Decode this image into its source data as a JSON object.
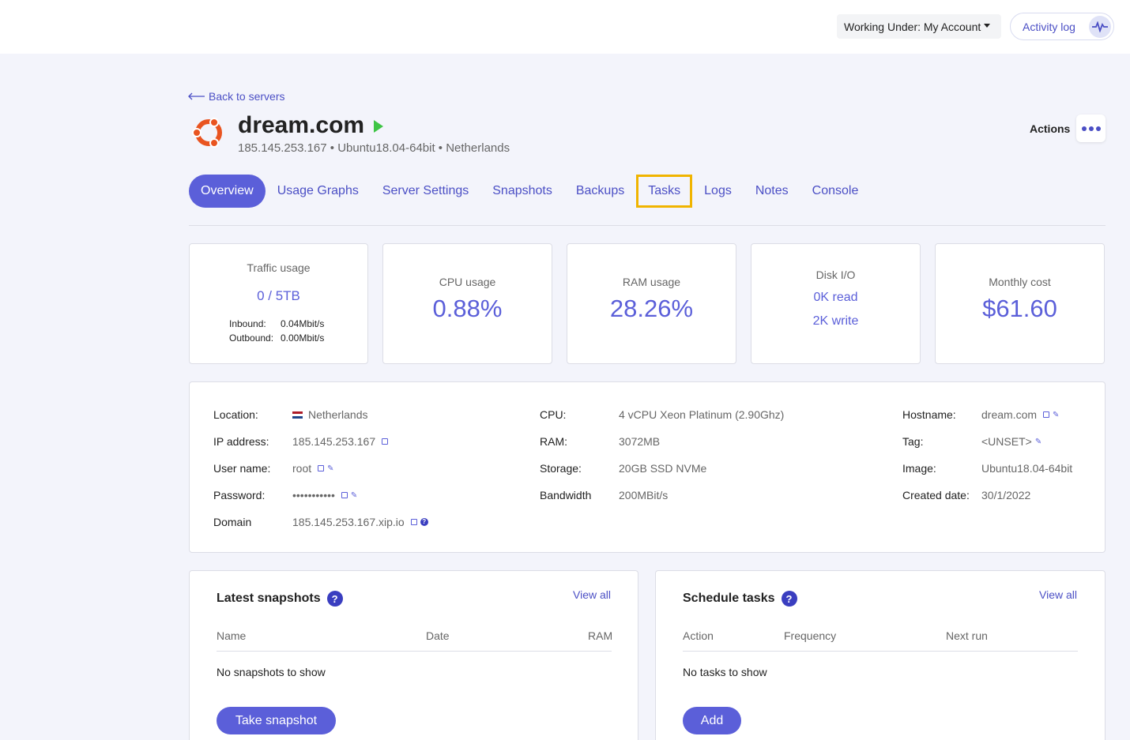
{
  "topbar": {
    "working_under": "Working Under: My Account",
    "activity_log": "Activity log"
  },
  "header": {
    "back_label": "Back to servers",
    "server_name": "dream.com",
    "subtitle": "185.145.253.167 • Ubuntu18.04-64bit • Netherlands",
    "actions_label": "Actions"
  },
  "tabs": [
    {
      "label": "Overview",
      "active": true
    },
    {
      "label": "Usage Graphs"
    },
    {
      "label": "Server Settings"
    },
    {
      "label": "Snapshots"
    },
    {
      "label": "Backups"
    },
    {
      "label": "Tasks",
      "highlighted": true
    },
    {
      "label": "Logs"
    },
    {
      "label": "Notes"
    },
    {
      "label": "Console"
    }
  ],
  "stats": {
    "traffic": {
      "label": "Traffic usage",
      "value": "0 / 5TB",
      "inbound_label": "Inbound:",
      "inbound_value": "0.04Mbit/s",
      "outbound_label": "Outbound:",
      "outbound_value": "0.00Mbit/s"
    },
    "cpu": {
      "label": "CPU usage",
      "value": "0.88%"
    },
    "ram": {
      "label": "RAM usage",
      "value": "28.26%"
    },
    "disk": {
      "label": "Disk I/O",
      "read": "0K read",
      "write": "2K write"
    },
    "cost": {
      "label": "Monthly cost",
      "value": "$61.60"
    }
  },
  "info": {
    "location_label": "Location:",
    "location": "Netherlands",
    "ip_label": "IP address:",
    "ip": "185.145.253.167",
    "user_label": "User name:",
    "user": "root",
    "password_label": "Password:",
    "password": "•••••••••••",
    "domain_label": "Domain",
    "domain": "185.145.253.167.xip.io",
    "cpu_label": "CPU:",
    "cpu": "4 vCPU Xeon Platinum (2.90Ghz)",
    "ram_label": "RAM:",
    "ram": "3072MB",
    "storage_label": "Storage:",
    "storage": "20GB SSD NVMe",
    "bandwidth_label": "Bandwidth",
    "bandwidth": "200MBit/s",
    "hostname_label": "Hostname:",
    "hostname": "dream.com",
    "tag_label": "Tag:",
    "tag": "<UNSET>",
    "image_label": "Image:",
    "image": "Ubuntu18.04-64bit",
    "created_label": "Created date:",
    "created": "30/1/2022"
  },
  "snapshots": {
    "title": "Latest snapshots",
    "view_all": "View all",
    "columns": [
      "Name",
      "Date",
      "RAM"
    ],
    "empty": "No snapshots to show",
    "button": "Take snapshot"
  },
  "tasks": {
    "title": "Schedule tasks",
    "view_all": "View all",
    "columns": [
      "Action",
      "Frequency",
      "Next run"
    ],
    "empty": "No tasks to show",
    "button": "Add"
  },
  "colors": {
    "accent": "#5b5fd9",
    "link": "#4b4fc5",
    "highlight": "#f0b400",
    "running": "#3ec545"
  }
}
